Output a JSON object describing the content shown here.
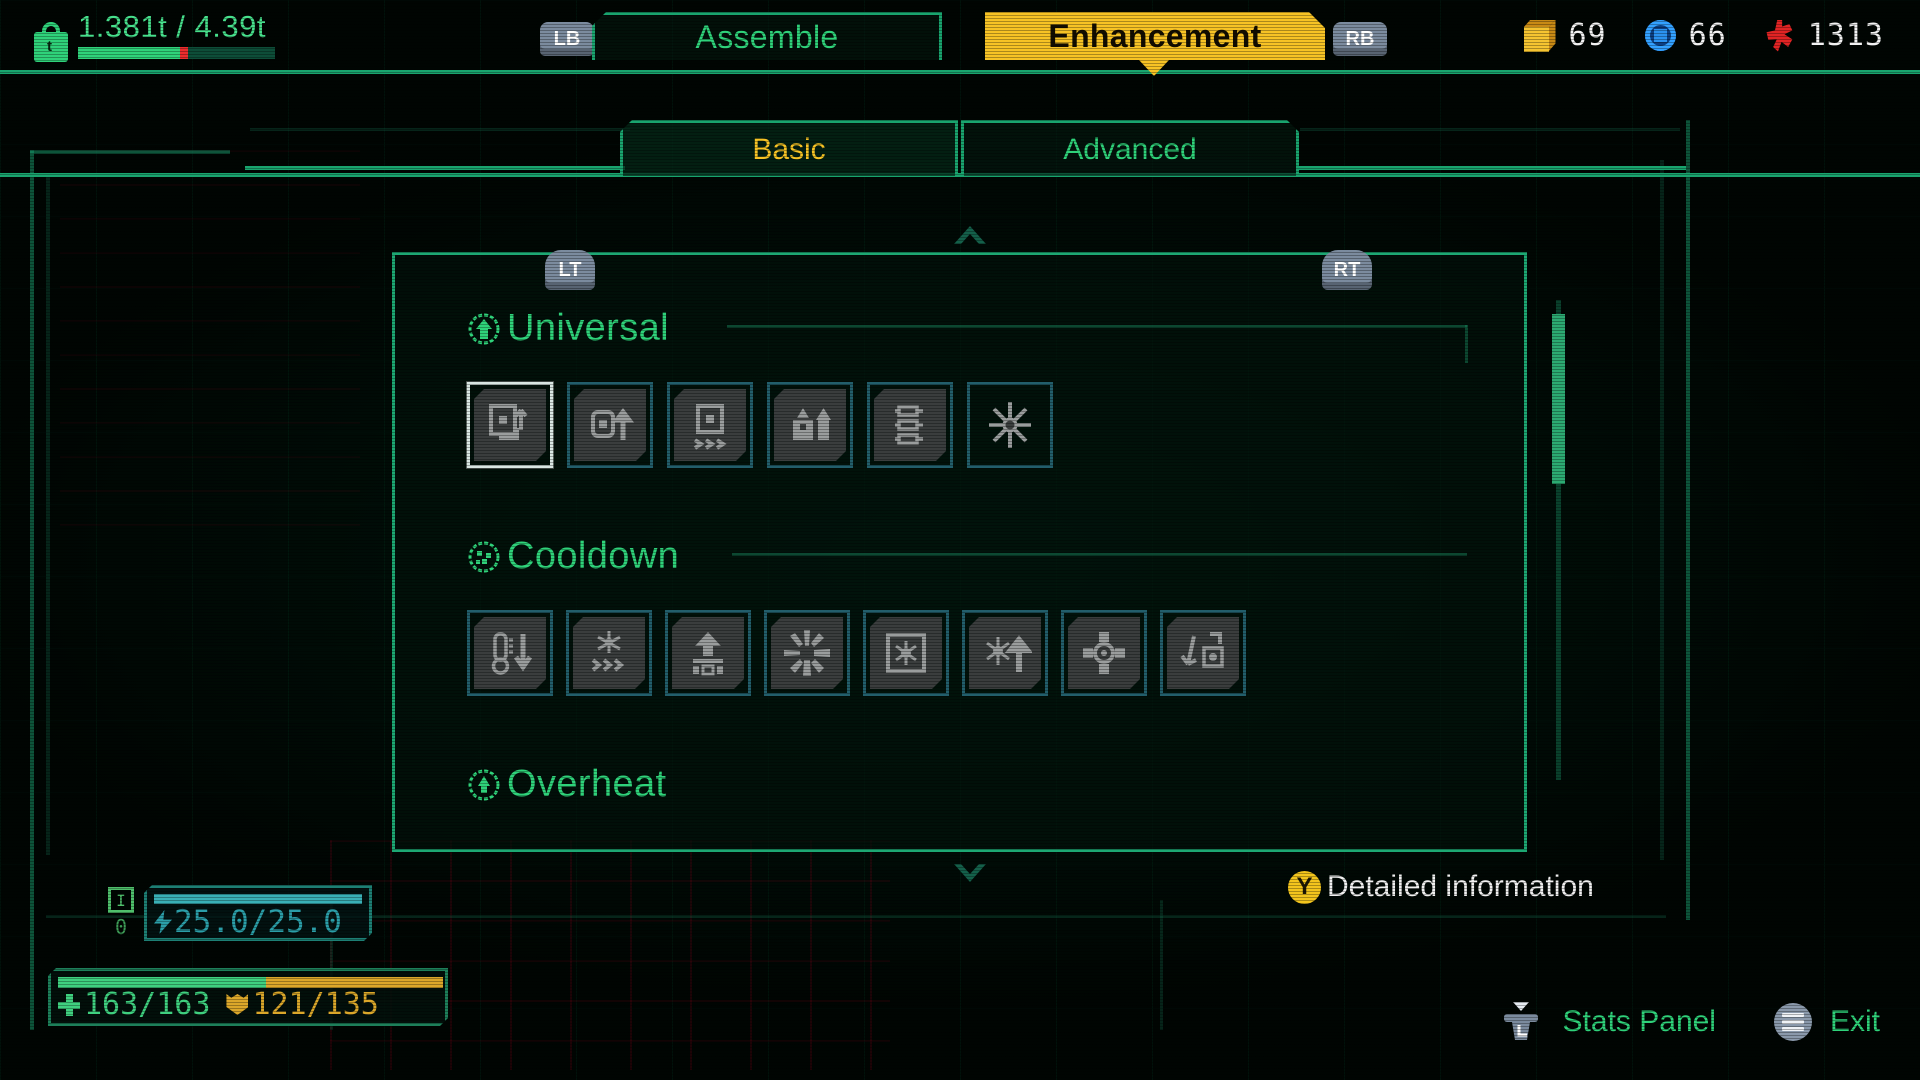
{
  "hud": {
    "mass": {
      "icon": "weight-lock-icon",
      "value": "1.381t / 4.39t",
      "fill_percent": 52,
      "marker_percent": 52
    },
    "resources": [
      {
        "icon": "yellow-cube-icon",
        "name": "alloy",
        "value": "69"
      },
      {
        "icon": "blue-chip-icon",
        "name": "chip",
        "value": "66"
      },
      {
        "icon": "red-crystal-icon",
        "name": "core",
        "value": "1313"
      }
    ]
  },
  "nav": {
    "lb_button": "LB",
    "rb_button": "RB",
    "tabs": [
      {
        "label": "Assemble",
        "selected": false
      },
      {
        "label": "Enhancement",
        "selected": true
      }
    ]
  },
  "subnav": {
    "lt_button": "LT",
    "rt_button": "RT",
    "tabs": [
      {
        "label": "Basic",
        "selected": true
      },
      {
        "label": "Advanced",
        "selected": false
      }
    ]
  },
  "panel": {
    "scroll_up": "scroll-up-arrow",
    "scroll_down": "scroll-down-arrow",
    "scrollbar": {
      "thumb_percent": 35,
      "position_percent": 3
    },
    "sections": [
      {
        "id": "universal",
        "title": "Universal",
        "icon": "circle-up-arrow-icon",
        "items": [
          {
            "id": "u1",
            "icon": "module-swap-icon",
            "selected": true
          },
          {
            "id": "u2",
            "icon": "module-boost-icon",
            "selected": false
          },
          {
            "id": "u3",
            "icon": "module-burst-icon",
            "selected": false
          },
          {
            "id": "u4",
            "icon": "dual-boost-icon",
            "selected": false
          },
          {
            "id": "u5",
            "icon": "triple-capsule-icon",
            "selected": false
          },
          {
            "id": "u6",
            "icon": "starburst-icon",
            "selected": false
          }
        ]
      },
      {
        "id": "cooldown",
        "title": "Cooldown",
        "icon": "circle-dots-icon",
        "items": [
          {
            "id": "c1",
            "icon": "thermometer-down-icon",
            "selected": false
          },
          {
            "id": "c2",
            "icon": "snowflake-chevrons-icon",
            "selected": false
          },
          {
            "id": "c3",
            "icon": "vent-up-icon",
            "selected": false
          },
          {
            "id": "c4",
            "icon": "shatter-icon",
            "selected": false
          },
          {
            "id": "c5",
            "icon": "framed-snowflake-icon",
            "selected": false
          },
          {
            "id": "c6",
            "icon": "snowflake-up-icon",
            "selected": false
          },
          {
            "id": "c7",
            "icon": "dpad-core-icon",
            "selected": false
          },
          {
            "id": "c8",
            "icon": "recycle-arrows-icon",
            "selected": false
          }
        ]
      },
      {
        "id": "overheat",
        "title": "Overheat",
        "icon": "circle-flame-icon",
        "items": []
      }
    ]
  },
  "footer": {
    "detailed_info": {
      "button": "Y",
      "label": "Detailed information"
    },
    "stats_panel": {
      "button": "L",
      "label": "Stats Panel"
    },
    "exit": {
      "button": "menu-icon",
      "label": "Exit"
    }
  },
  "status": {
    "energy": {
      "slot_label": "I",
      "slot_count": "0",
      "value": "25.0/25.0",
      "fill_percent": 100
    },
    "hp": {
      "value": "163/163",
      "fill_percent": 100
    },
    "shield": {
      "value": "121/135",
      "fill_percent": 90
    }
  }
}
